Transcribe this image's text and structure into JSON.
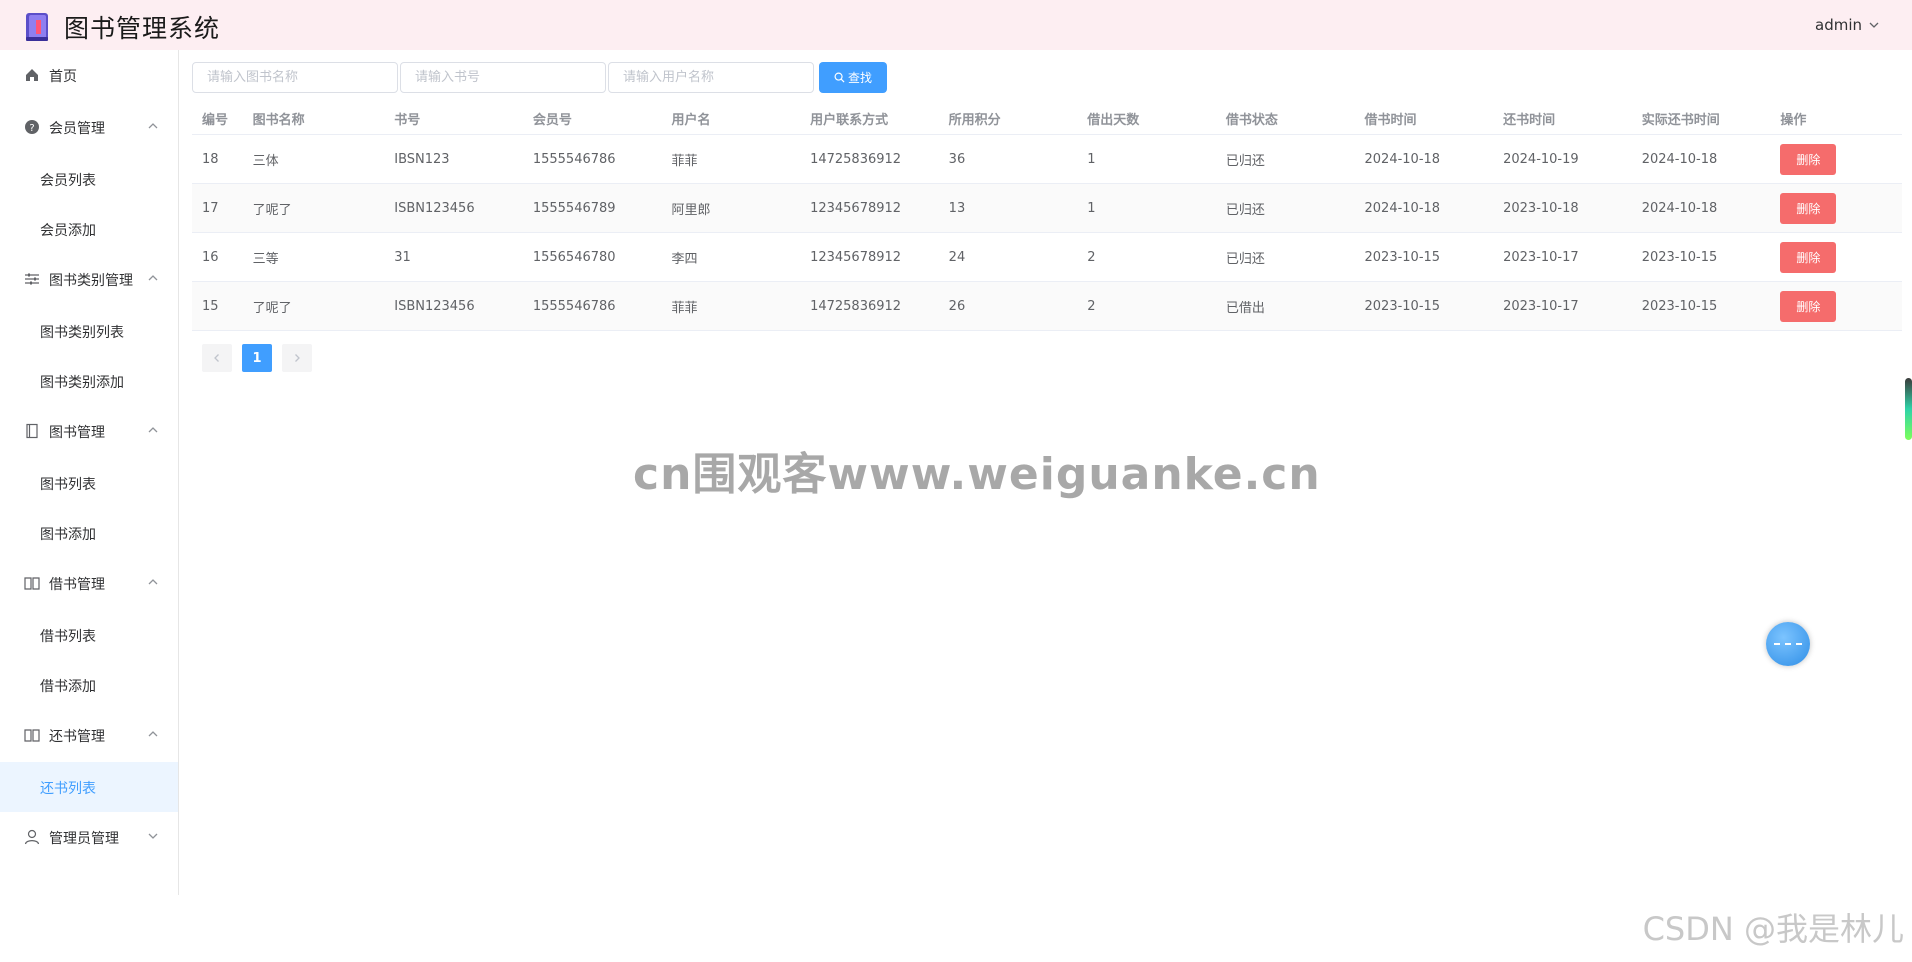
{
  "header": {
    "title": "图书管理系统",
    "user": "admin"
  },
  "sidebar": {
    "items": [
      {
        "label": "首页",
        "icon": "home-icon"
      },
      {
        "label": "会员管理",
        "icon": "question-circle-icon",
        "children": [
          "会员列表",
          "会员添加"
        ]
      },
      {
        "label": "图书类别管理",
        "icon": "sliders-icon",
        "children": [
          "图书类别列表",
          "图书类别添加"
        ]
      },
      {
        "label": "图书管理",
        "icon": "notebook-icon",
        "children": [
          "图书列表",
          "图书添加"
        ]
      },
      {
        "label": "借书管理",
        "icon": "open-book-icon",
        "children": [
          "借书列表",
          "借书添加"
        ]
      },
      {
        "label": "还书管理",
        "icon": "open-book-icon",
        "children": [
          "还书列表"
        ]
      },
      {
        "label": "管理员管理",
        "icon": "user-icon"
      }
    ],
    "active": "还书列表"
  },
  "search": {
    "book_name_placeholder": "请输入图书名称",
    "book_no_placeholder": "请输入书号",
    "user_name_placeholder": "请输入用户名称",
    "button": "查找"
  },
  "table": {
    "columns": [
      "编号",
      "图书名称",
      "书号",
      "会员号",
      "用户名",
      "用户联系方式",
      "所用积分",
      "借出天数",
      "借书状态",
      "借书时间",
      "还书时间",
      "实际还书时间",
      "操作"
    ],
    "rows": [
      {
        "id": "18",
        "book": "三体",
        "isbn": "IBSN123",
        "member": "1555546786",
        "user": "菲菲",
        "phone": "14725836912",
        "points": "36",
        "days": "1",
        "status": "已归还",
        "borrow": "2024-10-18",
        "due": "2024-10-19",
        "returned": "2024-10-18"
      },
      {
        "id": "17",
        "book": "了呢了",
        "isbn": "ISBN123456",
        "member": "1555546789",
        "user": "阿里郎",
        "phone": "12345678912",
        "points": "13",
        "days": "1",
        "status": "已归还",
        "borrow": "2024-10-18",
        "due": "2023-10-18",
        "returned": "2024-10-18"
      },
      {
        "id": "16",
        "book": "三等",
        "isbn": "31",
        "member": "1556546780",
        "user": "李四",
        "phone": "12345678912",
        "points": "24",
        "days": "2",
        "status": "已归还",
        "borrow": "2023-10-15",
        "due": "2023-10-17",
        "returned": "2023-10-15"
      },
      {
        "id": "15",
        "book": "了呢了",
        "isbn": "ISBN123456",
        "member": "1555546786",
        "user": "菲菲",
        "phone": "14725836912",
        "points": "26",
        "days": "2",
        "status": "已借出",
        "borrow": "2023-10-15",
        "due": "2023-10-17",
        "returned": "2023-10-15"
      }
    ],
    "delete_label": "删除"
  },
  "pagination": {
    "current": "1"
  },
  "watermark": "cn围观客www.weiguanke.cn",
  "credit": "CSDN @我是林儿",
  "colors": {
    "primary": "#409eff",
    "danger": "#f56c6c",
    "header_bg": "#fdeef2"
  }
}
